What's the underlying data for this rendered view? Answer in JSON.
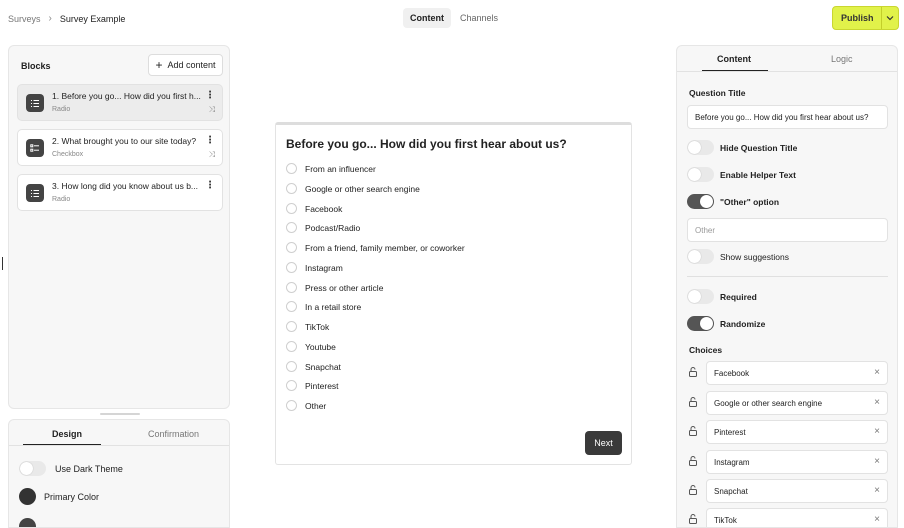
{
  "breadcrumb": {
    "root": "Surveys",
    "separator": "›",
    "current": "Survey Example"
  },
  "center_tabs": [
    {
      "label": "Content",
      "active": true
    },
    {
      "label": "Channels",
      "active": false
    }
  ],
  "publish": {
    "label": "Publish",
    "color": "#e1f24a"
  },
  "left": {
    "title": "Blocks",
    "add_label": "Add content",
    "blocks": [
      {
        "title": "1. Before you go... How did you first h...",
        "type": "Radio",
        "icon": "list-icon",
        "selected": true
      },
      {
        "title": "2. What brought you to our site today?",
        "type": "Checkbox",
        "icon": "checklist-icon",
        "selected": false
      },
      {
        "title": "3. How long did you know about us b...",
        "type": "Radio",
        "icon": "list-icon",
        "selected": false
      }
    ]
  },
  "design": {
    "tabs": [
      {
        "label": "Design",
        "active": true
      },
      {
        "label": "Confirmation",
        "active": false
      }
    ],
    "dark_theme_label": "Use Dark Theme",
    "dark_theme_on": false,
    "primary_color_label": "Primary Color",
    "primary_color": "#333333"
  },
  "preview": {
    "question": "Before you go... How did you first hear about us?",
    "options": [
      "From an influencer",
      "Google or other search engine",
      "Facebook",
      "Podcast/Radio",
      "From a friend, family member, or coworker",
      "Instagram",
      "Press or other article",
      "In a retail store",
      "TikTok",
      "Youtube",
      "Snapchat",
      "Pinterest",
      "Other"
    ],
    "next_label": "Next"
  },
  "right": {
    "tabs": [
      {
        "label": "Content",
        "active": true
      },
      {
        "label": "Logic",
        "active": false
      }
    ],
    "question_title_label": "Question Title",
    "question_title_value": "Before you go... How did you first hear about us?",
    "hide_title_label": "Hide Question Title",
    "hide_title_on": false,
    "helper_text_label": "Enable Helper Text",
    "helper_text_on": false,
    "other_option_label": "\"Other\" option",
    "other_option_on": true,
    "other_placeholder": "Other",
    "show_suggestions_label": "Show suggestions",
    "show_suggestions_on": false,
    "required_label": "Required",
    "required_on": false,
    "randomize_label": "Randomize",
    "randomize_on": true,
    "choices_label": "Choices",
    "choices": [
      "Facebook",
      "Google or other search engine",
      "Pinterest",
      "Instagram",
      "Snapchat",
      "TikTok"
    ]
  }
}
